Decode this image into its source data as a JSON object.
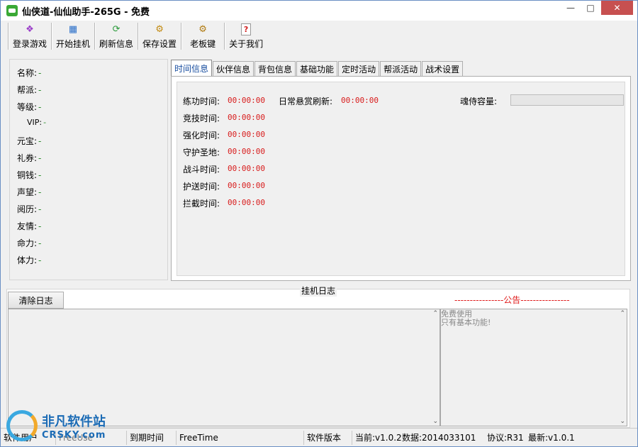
{
  "window": {
    "title": "仙侠道-仙仙助手-265G - 免费"
  },
  "toolbar": {
    "buttons": [
      {
        "label": "登录游戏",
        "icon": "gamepad-icon"
      },
      {
        "label": "开始挂机",
        "icon": "computer-user-icon"
      },
      {
        "label": "刷新信息",
        "icon": "refresh-icon"
      },
      {
        "label": "保存设置",
        "icon": "settings-save-icon"
      },
      {
        "label": "老板键",
        "icon": "key-icon"
      },
      {
        "label": "关于我们",
        "icon": "help-icon"
      }
    ]
  },
  "player_info": [
    {
      "key": "名称:",
      "value": "-"
    },
    {
      "key": "帮派:",
      "value": "-"
    },
    {
      "key": "等级:",
      "value": "-"
    },
    {
      "key": "VIP:",
      "value": "-"
    },
    {
      "key": "元宝:",
      "value": "-"
    },
    {
      "key": "礼券:",
      "value": "-"
    },
    {
      "key": "铜钱:",
      "value": "-"
    },
    {
      "key": "声望:",
      "value": "-"
    },
    {
      "key": "阅历:",
      "value": "-"
    },
    {
      "key": "友情:",
      "value": "-"
    },
    {
      "key": "命力:",
      "value": "-"
    },
    {
      "key": "体力:",
      "value": "-"
    }
  ],
  "tabs": [
    "时间信息",
    "伙伴信息",
    "背包信息",
    "基础功能",
    "定时活动",
    "帮派活动",
    "战术设置"
  ],
  "active_tab": "时间信息",
  "time_info": {
    "rows": [
      {
        "label": "练功时间:",
        "value": "00:00:00"
      },
      {
        "label": "竞技时间:",
        "value": "00:00:00"
      },
      {
        "label": "强化时间:",
        "value": "00:00:00"
      },
      {
        "label": "守护圣地:",
        "value": "00:00:00"
      },
      {
        "label": "战斗时间:",
        "value": "00:00:00"
      },
      {
        "label": "护送时间:",
        "value": "00:00:00"
      },
      {
        "label": "拦截时间:",
        "value": "00:00:00"
      }
    ],
    "daily_refresh_label": "日常悬赏刷新:",
    "daily_refresh_value": "00:00:00",
    "soul_capacity_label": "魂侍容量:"
  },
  "log": {
    "title": "挂机日志",
    "clear_label": "清除日志",
    "announcement_title": "----------------公告----------------",
    "notice_lines": [
      "免费使用",
      "只有基本功能!"
    ]
  },
  "statusbar": {
    "user_label": "软件用户",
    "user_value": "FreeUse",
    "expire_label": "到期时间",
    "expire_value": "FreeTime",
    "version_label": "软件版本",
    "current": "当前:v1.0.2",
    "data": "数据:2014033101",
    "protocol": "协议:R31",
    "latest": "最新:v1.0.1"
  },
  "watermark": {
    "name": "非凡软件站",
    "domain": "CRSKY.com"
  }
}
